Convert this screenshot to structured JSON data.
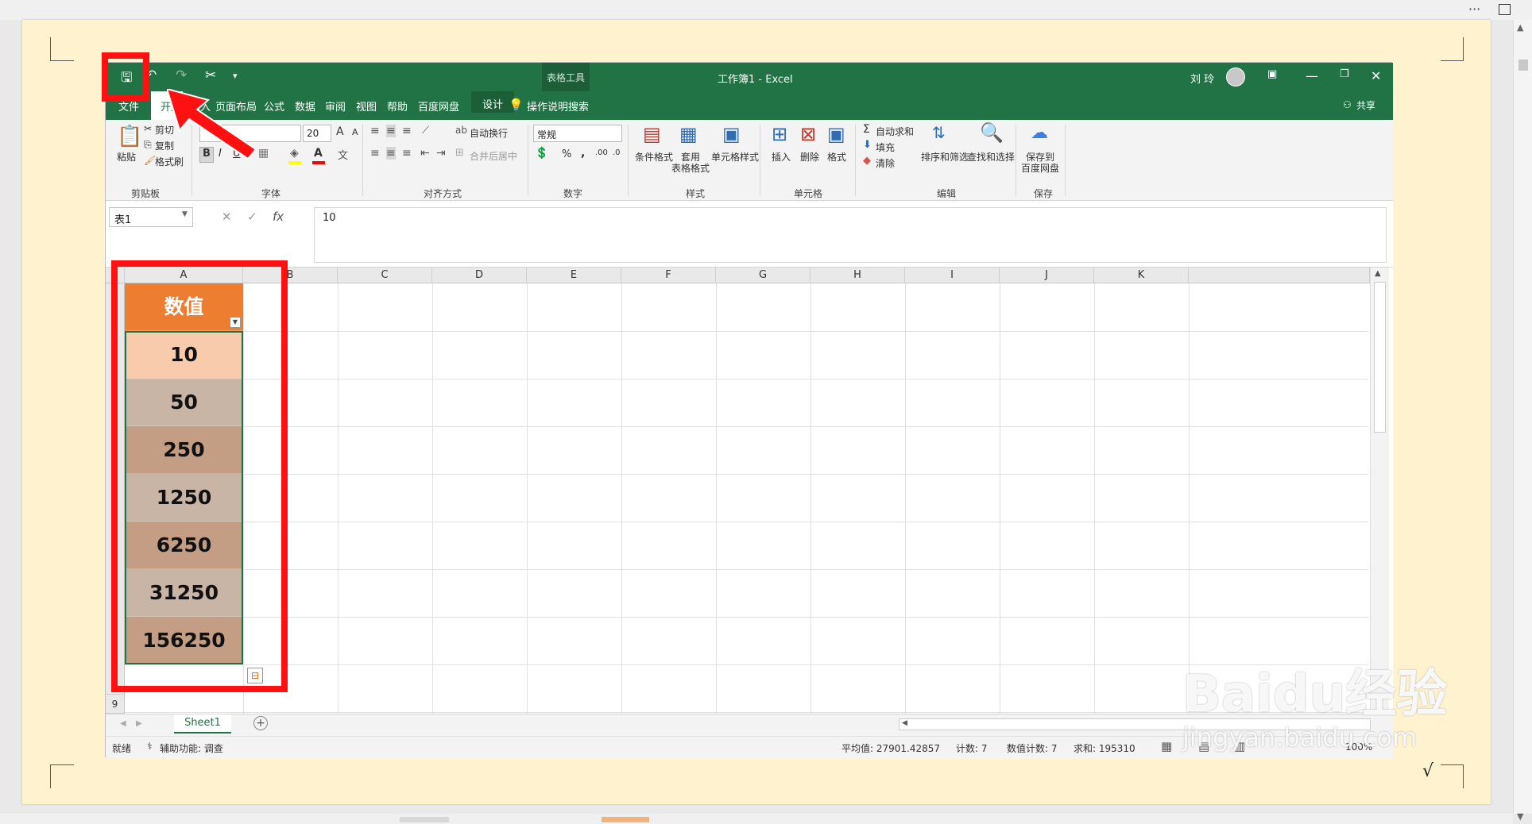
{
  "excel": {
    "qat": {
      "save": "🖫",
      "undo": "↶",
      "redo": "↷",
      "cut": "✂",
      "more": "▾"
    },
    "title": "工作簿1  -  Excel",
    "context_tab_group": "表格工具",
    "user_name": "刘 玲",
    "tabs": [
      "文件",
      "开始",
      "插入",
      "页面布局",
      "公式",
      "数据",
      "审阅",
      "视图",
      "帮助",
      "百度网盘",
      "设计"
    ],
    "tell_me": "操作说明搜索",
    "share": "共享",
    "ribbon": {
      "clipboard": {
        "paste": "粘贴",
        "cut": "剪切",
        "copy": "复制",
        "format_painter": "格式刷",
        "group": "剪贴板"
      },
      "font": {
        "font_size": "20",
        "bold": "B",
        "italic": "I",
        "underline": "U",
        "group": "字体",
        "grow": "A",
        "shrink": "A"
      },
      "alignment": {
        "wrap_text": "自动换行",
        "merge_center": "合并后居中",
        "group": "对齐方式"
      },
      "number": {
        "format": "常规",
        "percent": "%",
        "comma": ",",
        "group": "数字"
      },
      "styles": {
        "conditional": "条件格式",
        "as_table_1": "套用",
        "as_table_2": "表格格式",
        "cell_styles": "单元格样式",
        "group": "样式"
      },
      "cells": {
        "insert": "插入",
        "delete": "删除",
        "format": "格式",
        "group": "单元格"
      },
      "editing": {
        "autosum": "自动求和",
        "fill": "填充",
        "clear": "清除",
        "sort_filter": "排序和筛选",
        "find_select": "查找和选择",
        "group": "编辑"
      },
      "save": {
        "save_to_1": "保存到",
        "save_to_2": "百度网盘",
        "group": "保存"
      }
    },
    "formula_bar": {
      "name_box": "表1",
      "cancel": "✕",
      "enter": "✓",
      "fx": "fx",
      "value": "10"
    },
    "columns": [
      "A",
      "B",
      "C",
      "D",
      "E",
      "F",
      "G",
      "H",
      "I",
      "J",
      "K"
    ],
    "visible_row_label": "9",
    "cells": {
      "header": "数值",
      "values": [
        "10",
        "50",
        "250",
        "1250",
        "6250",
        "31250",
        "156250"
      ]
    },
    "sheet_tab": "Sheet1",
    "status": {
      "ready": "就绪",
      "accessibility": "辅助功能: 调查",
      "average": "平均值: 27901.42857",
      "count": "计数: 7",
      "numeric_count": "数值计数: 7",
      "sum": "求和: 195310",
      "zoom": "100%"
    }
  },
  "viewer": {
    "more": "···",
    "sqrt_mark": "√"
  },
  "watermark": {
    "brand": "Baidu经验",
    "url": "jingyan.baidu.com"
  },
  "colors": {
    "excel_green": "#217346",
    "header_fill": "#ED7D31",
    "row_fill_1": "#F8CBAD",
    "row_fill_alt": "#C9B5A6",
    "row_fill_dark": "#C49E84",
    "annotation_red": "#FF1111",
    "page_bg": "#FFF3CF"
  }
}
